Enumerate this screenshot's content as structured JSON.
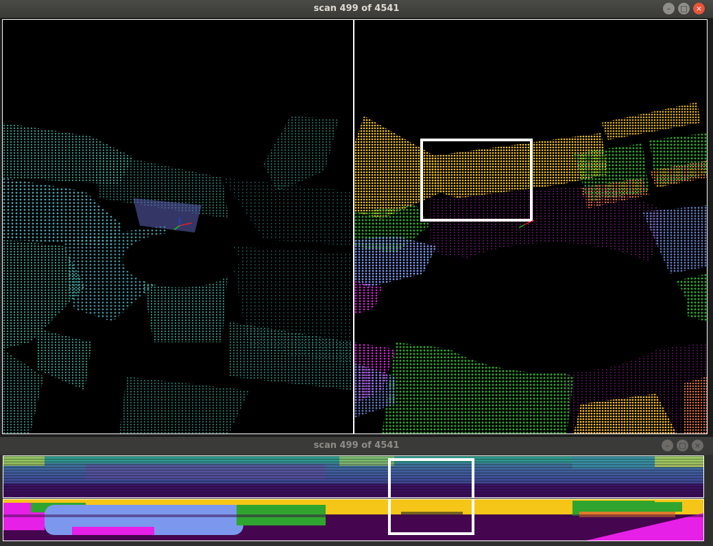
{
  "main_window": {
    "title": "scan 499 of 4541",
    "controls": {
      "minimize": "–",
      "maximize": "□",
      "close": "×"
    }
  },
  "range_window": {
    "title": "scan 499 of 4541",
    "controls": {
      "minimize": "–",
      "maximize": "□",
      "close": "×"
    }
  },
  "colors": {
    "scan_teal": "#2f9e8c",
    "label_car": "#f5c518",
    "label_vegetation": "#2fa52f",
    "label_sidewalk": "#8b1c8c",
    "label_road_marking": "#e620e6",
    "label_vehicle": "#6f8fe8",
    "label_terrain": "#e07a2a",
    "highlight_box": "#ffffff"
  }
}
